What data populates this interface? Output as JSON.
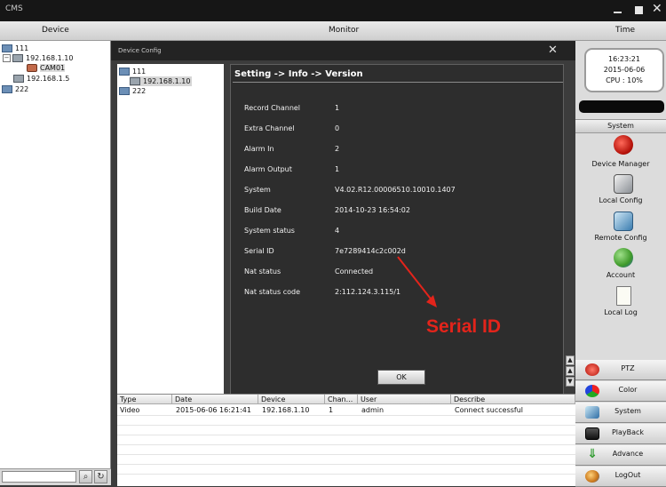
{
  "app": {
    "title": "CMS"
  },
  "header": {
    "device": "Device",
    "monitor": "Monitor",
    "time": "Time"
  },
  "tree": {
    "group1": "111",
    "device1": "192.168.1.10",
    "camera1": "CAM01",
    "device2": "192.168.1.5",
    "group2": "222"
  },
  "dialog": {
    "title": "Device Config",
    "tree": {
      "group1": "111",
      "device1": "192.168.1.10",
      "group2": "222"
    },
    "breadcrumb": "Setting -> Info -> Version",
    "info": [
      {
        "label": "Record Channel",
        "value": "1"
      },
      {
        "label": "Extra Channel",
        "value": "0"
      },
      {
        "label": "Alarm In",
        "value": "2"
      },
      {
        "label": "Alarm Output",
        "value": "1"
      },
      {
        "label": "System",
        "value": "V4.02.R12.00006510.10010.1407"
      },
      {
        "label": "Build Date",
        "value": "2014-10-23 16:54:02"
      },
      {
        "label": "System status",
        "value": "4"
      },
      {
        "label": "Serial ID",
        "value": "7e7289414c2c002d"
      },
      {
        "label": "Nat status",
        "value": "Connected"
      },
      {
        "label": "Nat status code",
        "value": "2:112.124.3.115/1"
      }
    ],
    "ok_label": "OK"
  },
  "annotation": {
    "text": "Serial ID",
    "color": "#e3241b"
  },
  "log": {
    "columns": [
      "Type",
      "Date",
      "Device",
      "Chan...",
      "User",
      "Describe"
    ],
    "rows": [
      [
        "Video",
        "2015-06-06 16:21:41",
        "192.168.1.10",
        "1",
        "admin",
        "Connect successful"
      ]
    ]
  },
  "status": {
    "time": "16:23:21",
    "date": "2015-06-06",
    "cpu": "CPU : 10%"
  },
  "system_menu": {
    "header": "System",
    "items": [
      {
        "label": "Device Manager",
        "icon": "device-manager-icon"
      },
      {
        "label": "Local Config",
        "icon": "local-config-icon"
      },
      {
        "label": "Remote Config",
        "icon": "remote-config-icon"
      },
      {
        "label": "Account",
        "icon": "account-icon"
      },
      {
        "label": "Local Log",
        "icon": "local-log-icon"
      }
    ]
  },
  "nav_buttons": [
    {
      "label": "PTZ",
      "icon": "ptz-icon"
    },
    {
      "label": "Color",
      "icon": "color-icon"
    },
    {
      "label": "System",
      "icon": "system-icon"
    },
    {
      "label": "PlayBack",
      "icon": "playback-icon"
    },
    {
      "label": "Advance",
      "icon": "advance-icon"
    },
    {
      "label": "LogOut",
      "icon": "logout-icon"
    }
  ]
}
